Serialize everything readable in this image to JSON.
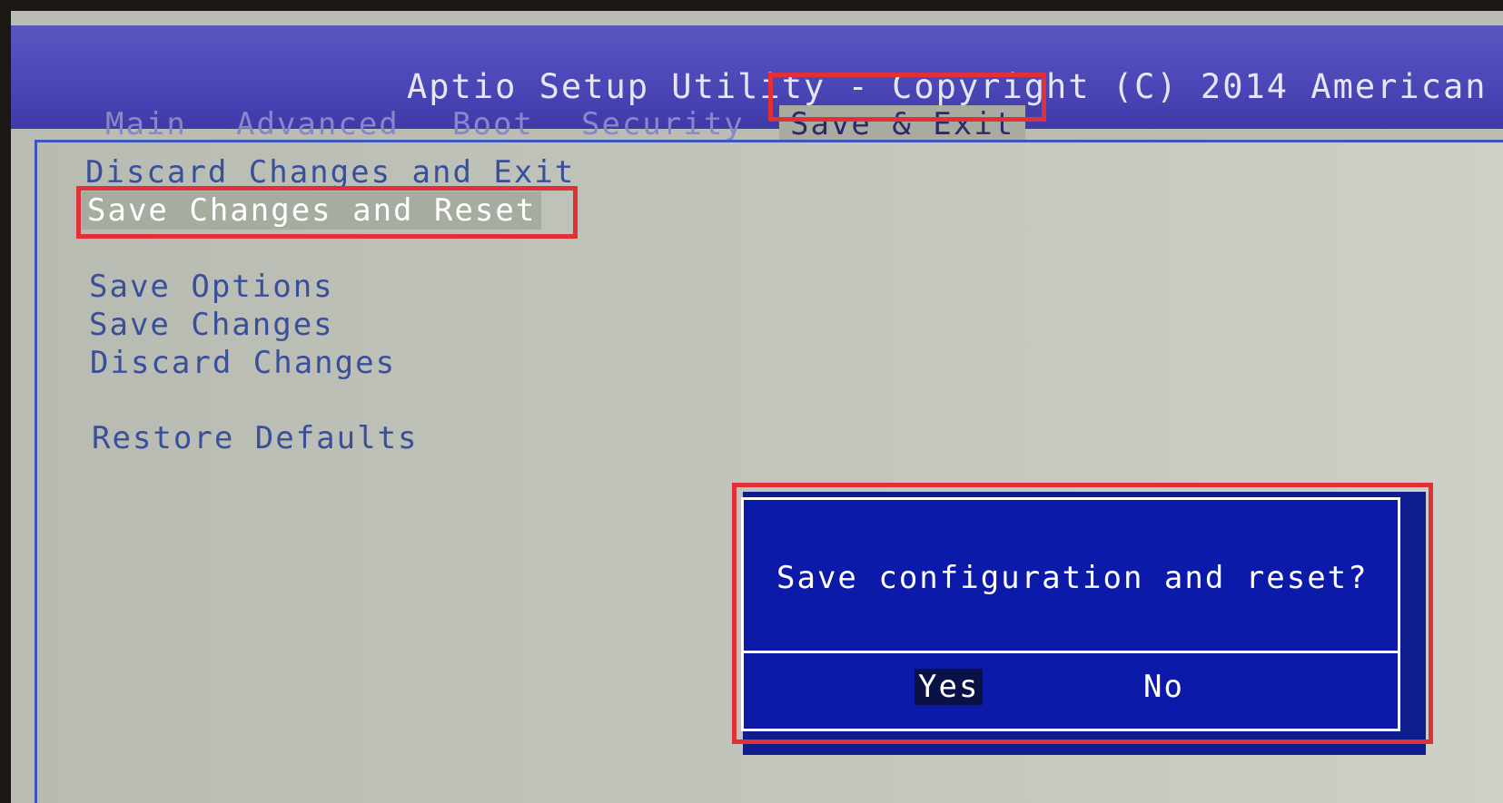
{
  "header": {
    "title": "Aptio Setup Utility - Copyright (C) 2014 American"
  },
  "tabs": [
    {
      "label": "Main"
    },
    {
      "label": "Advanced"
    },
    {
      "label": "Boot"
    },
    {
      "label": "Security"
    },
    {
      "label": "Save & Exit",
      "active": true
    }
  ],
  "menu": {
    "items": [
      {
        "label": "Discard Changes and Exit"
      },
      {
        "label": "Save Changes and Reset",
        "selected": true
      },
      {
        "label": "Save Options"
      },
      {
        "label": "Save Changes"
      },
      {
        "label": "Discard Changes"
      },
      {
        "label": "Restore Defaults"
      }
    ]
  },
  "dialog": {
    "message": "Save configuration and reset?",
    "yes_label": "Yes",
    "no_label": "No",
    "focused": "Yes"
  },
  "colors": {
    "header_bg": "#4b46b6",
    "panel_bg": "#c3c6bc",
    "menu_text": "#3a4f9a",
    "dialog_bg": "#0b1aa8",
    "highlight_border": "#e23038"
  }
}
